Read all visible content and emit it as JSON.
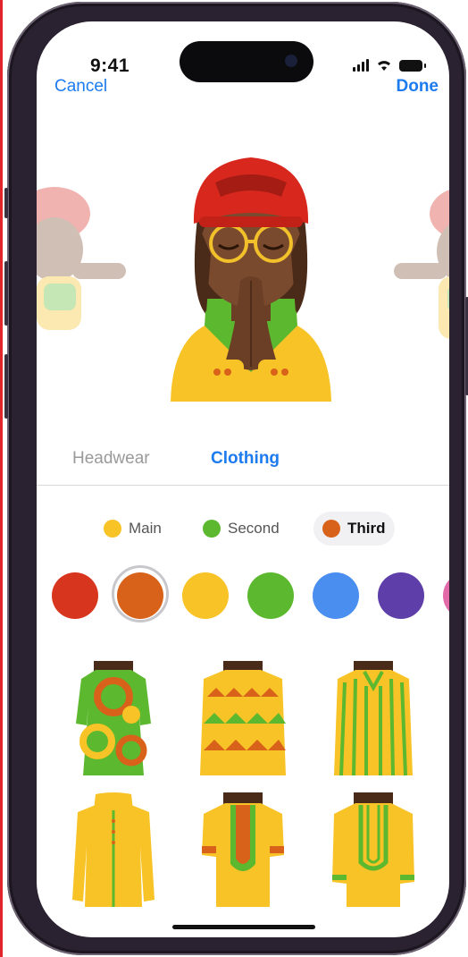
{
  "status_bar": {
    "time": "9:41",
    "icons": [
      "cellular-signal-icon",
      "wifi-icon",
      "battery-icon"
    ]
  },
  "nav": {
    "cancel_label": "Cancel",
    "done_label": "Done"
  },
  "category_tabs": [
    {
      "label": "Headwear",
      "selected": false
    },
    {
      "label": "Clothing",
      "selected": true
    }
  ],
  "color_slots": [
    {
      "label": "Main",
      "color": "#f7c326",
      "selected": false
    },
    {
      "label": "Second",
      "color": "#5cb82e",
      "selected": false
    },
    {
      "label": "Third",
      "color": "#d9621a",
      "selected": true
    }
  ],
  "swatches": [
    {
      "name": "red",
      "color": "#d8351f",
      "selected": false
    },
    {
      "name": "orange",
      "color": "#d9621a",
      "selected": true
    },
    {
      "name": "yellow",
      "color": "#f7c326",
      "selected": false
    },
    {
      "name": "green",
      "color": "#5cb82e",
      "selected": false
    },
    {
      "name": "blue",
      "color": "#4a8ef0",
      "selected": false
    },
    {
      "name": "purple",
      "color": "#5e3ea8",
      "selected": false
    },
    {
      "name": "pink",
      "color": "#e26aa8",
      "selected": false
    }
  ],
  "clothing_options": [
    {
      "name": "swirl-print-dress"
    },
    {
      "name": "triangle-print-dress"
    },
    {
      "name": "striped-dress"
    },
    {
      "name": "hooded-robe"
    },
    {
      "name": "embroidered-dashiki"
    },
    {
      "name": "plain-dashiki"
    }
  ],
  "colors": {
    "accent": "#1d7bf0",
    "helmet_red": "#d8281e",
    "skin": "#7a4a2e",
    "shirt_yellow": "#f7c326",
    "vest_green": "#5cb82e"
  }
}
